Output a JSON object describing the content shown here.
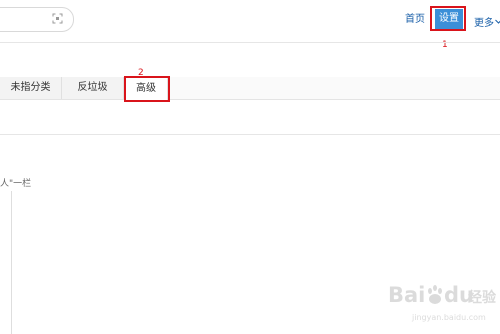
{
  "header": {
    "home_label": "首页",
    "settings_label": "设置",
    "more_label": "更多"
  },
  "tabs": [
    {
      "label": "未指分类"
    },
    {
      "label": "反垃圾"
    },
    {
      "label": "高级",
      "active": true
    }
  ],
  "annotations": {
    "settings_number": "1",
    "tab_number": "2"
  },
  "content": {
    "partial_text": "人\"一栏"
  },
  "watermark": {
    "brand": "Bai",
    "brand2": "du",
    "cn": "经验",
    "url": "jingyan.baidu.com"
  },
  "colors": {
    "accent": "#3b8fd8",
    "annotation": "#d9141b",
    "link": "#1a5fa8"
  }
}
